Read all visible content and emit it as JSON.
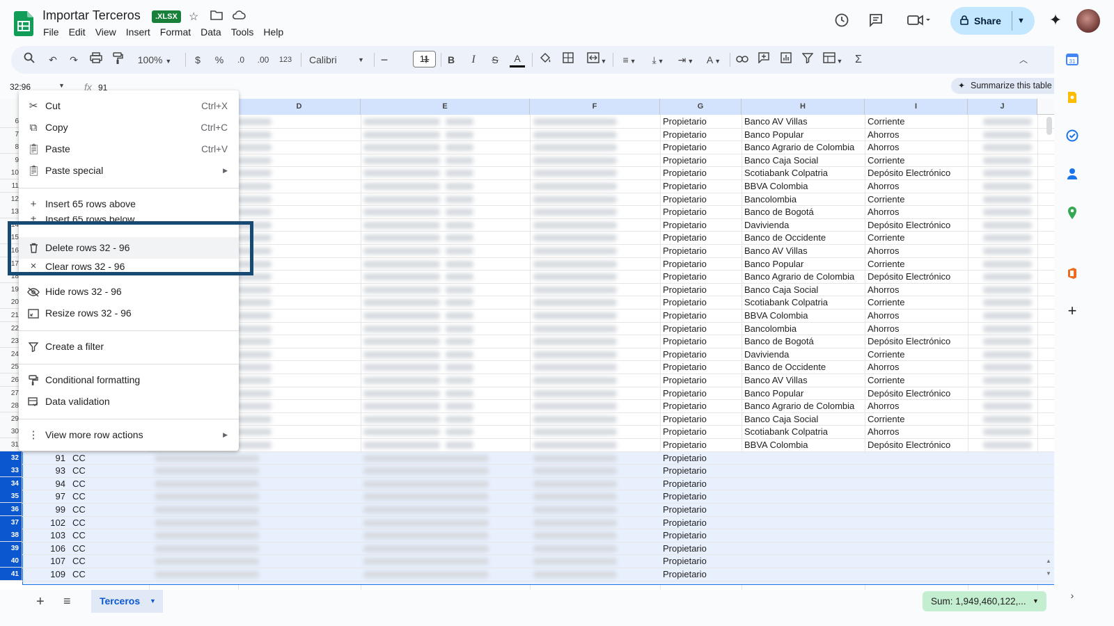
{
  "doc": {
    "title": "Importar Terceros",
    "badge": ".XLSX"
  },
  "menu": [
    "File",
    "Edit",
    "View",
    "Insert",
    "Format",
    "Data",
    "Tools",
    "Help"
  ],
  "share": {
    "label": "Share"
  },
  "toolbar": {
    "zoom": "100%",
    "currency": "$",
    "percent": "%",
    "dec_decrease": ".0",
    "dec_increase": ".00",
    "format_123": "123",
    "font": "Calibri",
    "font_size": "11"
  },
  "formula": {
    "name_box": "32:96",
    "fx": "fx",
    "value": "91"
  },
  "summarize": {
    "label": "Summarize this table"
  },
  "columns": [
    "D",
    "E",
    "F",
    "G",
    "H",
    "I",
    "J"
  ],
  "rows_top": [
    {
      "n": "6",
      "g": "Propietario",
      "h": "Banco AV Villas",
      "i": "Corriente"
    },
    {
      "n": "7",
      "g": "Propietario",
      "h": "Banco Popular",
      "i": "Ahorros"
    },
    {
      "n": "8",
      "g": "Propietario",
      "h": "Banco Agrario de Colombia",
      "i": "Ahorros"
    },
    {
      "n": "9",
      "g": "Propietario",
      "h": "Banco Caja Social",
      "i": "Corriente"
    },
    {
      "n": "10",
      "g": "Propietario",
      "h": "Scotiabank Colpatria",
      "i": "Depósito Electrónico"
    },
    {
      "n": "11",
      "g": "Propietario",
      "h": "BBVA Colombia",
      "i": "Ahorros"
    },
    {
      "n": "12",
      "g": "Propietario",
      "h": "Bancolombia",
      "i": "Corriente"
    },
    {
      "n": "13",
      "g": "Propietario",
      "h": "Banco de Bogotá",
      "i": "Ahorros"
    },
    {
      "n": "14",
      "g": "Propietario",
      "h": "Davivienda",
      "i": "Depósito Electrónico"
    },
    {
      "n": "15",
      "g": "Propietario",
      "h": "Banco de Occidente",
      "i": "Corriente"
    },
    {
      "n": "16",
      "g": "Propietario",
      "h": "Banco AV Villas",
      "i": "Ahorros"
    },
    {
      "n": "17",
      "g": "Propietario",
      "h": "Banco Popular",
      "i": "Corriente"
    },
    {
      "n": "18",
      "g": "Propietario",
      "h": "Banco Agrario de Colombia",
      "i": "Depósito Electrónico"
    },
    {
      "n": "19",
      "g": "Propietario",
      "h": "Banco Caja Social",
      "i": "Ahorros"
    },
    {
      "n": "20",
      "g": "Propietario",
      "h": "Scotiabank Colpatria",
      "i": "Corriente"
    },
    {
      "n": "21",
      "g": "Propietario",
      "h": "BBVA Colombia",
      "i": "Ahorros"
    },
    {
      "n": "22",
      "g": "Propietario",
      "h": "Bancolombia",
      "i": "Ahorros"
    },
    {
      "n": "23",
      "g": "Propietario",
      "h": "Banco de Bogotá",
      "i": "Depósito Electrónico"
    },
    {
      "n": "24",
      "g": "Propietario",
      "h": "Davivienda",
      "i": "Corriente"
    },
    {
      "n": "25",
      "g": "Propietario",
      "h": "Banco de Occidente",
      "i": "Ahorros"
    },
    {
      "n": "26",
      "g": "Propietario",
      "h": "Banco AV Villas",
      "i": "Corriente"
    },
    {
      "n": "27",
      "g": "Propietario",
      "h": "Banco Popular",
      "i": "Depósito Electrónico"
    },
    {
      "n": "28",
      "g": "Propietario",
      "h": "Banco Agrario de Colombia",
      "i": "Ahorros"
    },
    {
      "n": "29",
      "g": "Propietario",
      "h": "Banco Caja Social",
      "i": "Corriente"
    },
    {
      "n": "30",
      "g": "Propietario",
      "h": "Scotiabank Colpatria",
      "i": "Ahorros"
    },
    {
      "n": "31",
      "g": "Propietario",
      "h": "BBVA Colombia",
      "i": "Depósito Electrónico"
    }
  ],
  "rows_selected": [
    {
      "n": "32",
      "a": "91",
      "b": "CC",
      "g": "Propietario"
    },
    {
      "n": "33",
      "a": "93",
      "b": "CC",
      "g": "Propietario"
    },
    {
      "n": "34",
      "a": "94",
      "b": "CC",
      "g": "Propietario"
    },
    {
      "n": "35",
      "a": "97",
      "b": "CC",
      "g": "Propietario"
    },
    {
      "n": "36",
      "a": "99",
      "b": "CC",
      "g": "Propietario"
    },
    {
      "n": "37",
      "a": "102",
      "b": "CC",
      "g": "Propietario"
    },
    {
      "n": "38",
      "a": "103",
      "b": "CC",
      "g": "Propietario"
    },
    {
      "n": "39",
      "a": "106",
      "b": "CC",
      "g": "Propietario"
    },
    {
      "n": "40",
      "a": "107",
      "b": "CC",
      "g": "Propietario"
    },
    {
      "n": "41",
      "a": "109",
      "b": "CC",
      "g": "Propietario"
    }
  ],
  "context_menu": {
    "cut": {
      "label": "Cut",
      "shortcut": "Ctrl+X"
    },
    "copy": {
      "label": "Copy",
      "shortcut": "Ctrl+C"
    },
    "paste": {
      "label": "Paste",
      "shortcut": "Ctrl+V"
    },
    "paste_special": {
      "label": "Paste special"
    },
    "insert_above": {
      "label": "Insert 65 rows above"
    },
    "insert_below": {
      "label": "Insert 65 rows below"
    },
    "delete_rows": {
      "label": "Delete rows 32 - 96"
    },
    "clear_rows": {
      "label": "Clear rows 32 - 96"
    },
    "hide_rows": {
      "label": "Hide rows 32 - 96"
    },
    "resize_rows": {
      "label": "Resize rows 32 - 96"
    },
    "create_filter": {
      "label": "Create a filter"
    },
    "conditional_formatting": {
      "label": "Conditional formatting"
    },
    "data_validation": {
      "label": "Data validation"
    },
    "more_row_actions": {
      "label": "View more row actions"
    }
  },
  "sheet_tab": {
    "label": "Terceros"
  },
  "sum": {
    "label": "Sum: 1,949,460,122,..."
  },
  "colors": {
    "accent": "#0b57d0",
    "share_bg": "#c2e7ff",
    "badge": "#188038",
    "highlight_frame": "#174a72",
    "sum_bg": "#c4eed0"
  }
}
